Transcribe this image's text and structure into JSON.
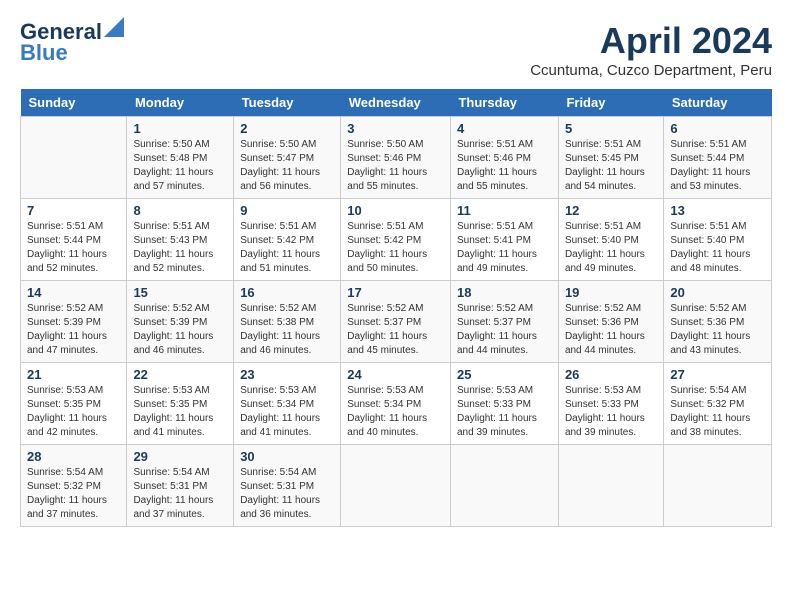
{
  "header": {
    "logo_line1": "General",
    "logo_line2": "Blue",
    "month_year": "April 2024",
    "location": "Ccuntuma, Cuzco Department, Peru"
  },
  "days_of_week": [
    "Sunday",
    "Monday",
    "Tuesday",
    "Wednesday",
    "Thursday",
    "Friday",
    "Saturday"
  ],
  "weeks": [
    [
      {
        "day": "",
        "sunrise": "",
        "sunset": "",
        "daylight": ""
      },
      {
        "day": "1",
        "sunrise": "Sunrise: 5:50 AM",
        "sunset": "Sunset: 5:48 PM",
        "daylight": "Daylight: 11 hours and 57 minutes."
      },
      {
        "day": "2",
        "sunrise": "Sunrise: 5:50 AM",
        "sunset": "Sunset: 5:47 PM",
        "daylight": "Daylight: 11 hours and 56 minutes."
      },
      {
        "day": "3",
        "sunrise": "Sunrise: 5:50 AM",
        "sunset": "Sunset: 5:46 PM",
        "daylight": "Daylight: 11 hours and 55 minutes."
      },
      {
        "day": "4",
        "sunrise": "Sunrise: 5:51 AM",
        "sunset": "Sunset: 5:46 PM",
        "daylight": "Daylight: 11 hours and 55 minutes."
      },
      {
        "day": "5",
        "sunrise": "Sunrise: 5:51 AM",
        "sunset": "Sunset: 5:45 PM",
        "daylight": "Daylight: 11 hours and 54 minutes."
      },
      {
        "day": "6",
        "sunrise": "Sunrise: 5:51 AM",
        "sunset": "Sunset: 5:44 PM",
        "daylight": "Daylight: 11 hours and 53 minutes."
      }
    ],
    [
      {
        "day": "7",
        "sunrise": "Sunrise: 5:51 AM",
        "sunset": "Sunset: 5:44 PM",
        "daylight": "Daylight: 11 hours and 52 minutes."
      },
      {
        "day": "8",
        "sunrise": "Sunrise: 5:51 AM",
        "sunset": "Sunset: 5:43 PM",
        "daylight": "Daylight: 11 hours and 52 minutes."
      },
      {
        "day": "9",
        "sunrise": "Sunrise: 5:51 AM",
        "sunset": "Sunset: 5:42 PM",
        "daylight": "Daylight: 11 hours and 51 minutes."
      },
      {
        "day": "10",
        "sunrise": "Sunrise: 5:51 AM",
        "sunset": "Sunset: 5:42 PM",
        "daylight": "Daylight: 11 hours and 50 minutes."
      },
      {
        "day": "11",
        "sunrise": "Sunrise: 5:51 AM",
        "sunset": "Sunset: 5:41 PM",
        "daylight": "Daylight: 11 hours and 49 minutes."
      },
      {
        "day": "12",
        "sunrise": "Sunrise: 5:51 AM",
        "sunset": "Sunset: 5:40 PM",
        "daylight": "Daylight: 11 hours and 49 minutes."
      },
      {
        "day": "13",
        "sunrise": "Sunrise: 5:51 AM",
        "sunset": "Sunset: 5:40 PM",
        "daylight": "Daylight: 11 hours and 48 minutes."
      }
    ],
    [
      {
        "day": "14",
        "sunrise": "Sunrise: 5:52 AM",
        "sunset": "Sunset: 5:39 PM",
        "daylight": "Daylight: 11 hours and 47 minutes."
      },
      {
        "day": "15",
        "sunrise": "Sunrise: 5:52 AM",
        "sunset": "Sunset: 5:39 PM",
        "daylight": "Daylight: 11 hours and 46 minutes."
      },
      {
        "day": "16",
        "sunrise": "Sunrise: 5:52 AM",
        "sunset": "Sunset: 5:38 PM",
        "daylight": "Daylight: 11 hours and 46 minutes."
      },
      {
        "day": "17",
        "sunrise": "Sunrise: 5:52 AM",
        "sunset": "Sunset: 5:37 PM",
        "daylight": "Daylight: 11 hours and 45 minutes."
      },
      {
        "day": "18",
        "sunrise": "Sunrise: 5:52 AM",
        "sunset": "Sunset: 5:37 PM",
        "daylight": "Daylight: 11 hours and 44 minutes."
      },
      {
        "day": "19",
        "sunrise": "Sunrise: 5:52 AM",
        "sunset": "Sunset: 5:36 PM",
        "daylight": "Daylight: 11 hours and 44 minutes."
      },
      {
        "day": "20",
        "sunrise": "Sunrise: 5:52 AM",
        "sunset": "Sunset: 5:36 PM",
        "daylight": "Daylight: 11 hours and 43 minutes."
      }
    ],
    [
      {
        "day": "21",
        "sunrise": "Sunrise: 5:53 AM",
        "sunset": "Sunset: 5:35 PM",
        "daylight": "Daylight: 11 hours and 42 minutes."
      },
      {
        "day": "22",
        "sunrise": "Sunrise: 5:53 AM",
        "sunset": "Sunset: 5:35 PM",
        "daylight": "Daylight: 11 hours and 41 minutes."
      },
      {
        "day": "23",
        "sunrise": "Sunrise: 5:53 AM",
        "sunset": "Sunset: 5:34 PM",
        "daylight": "Daylight: 11 hours and 41 minutes."
      },
      {
        "day": "24",
        "sunrise": "Sunrise: 5:53 AM",
        "sunset": "Sunset: 5:34 PM",
        "daylight": "Daylight: 11 hours and 40 minutes."
      },
      {
        "day": "25",
        "sunrise": "Sunrise: 5:53 AM",
        "sunset": "Sunset: 5:33 PM",
        "daylight": "Daylight: 11 hours and 39 minutes."
      },
      {
        "day": "26",
        "sunrise": "Sunrise: 5:53 AM",
        "sunset": "Sunset: 5:33 PM",
        "daylight": "Daylight: 11 hours and 39 minutes."
      },
      {
        "day": "27",
        "sunrise": "Sunrise: 5:54 AM",
        "sunset": "Sunset: 5:32 PM",
        "daylight": "Daylight: 11 hours and 38 minutes."
      }
    ],
    [
      {
        "day": "28",
        "sunrise": "Sunrise: 5:54 AM",
        "sunset": "Sunset: 5:32 PM",
        "daylight": "Daylight: 11 hours and 37 minutes."
      },
      {
        "day": "29",
        "sunrise": "Sunrise: 5:54 AM",
        "sunset": "Sunset: 5:31 PM",
        "daylight": "Daylight: 11 hours and 37 minutes."
      },
      {
        "day": "30",
        "sunrise": "Sunrise: 5:54 AM",
        "sunset": "Sunset: 5:31 PM",
        "daylight": "Daylight: 11 hours and 36 minutes."
      },
      {
        "day": "",
        "sunrise": "",
        "sunset": "",
        "daylight": ""
      },
      {
        "day": "",
        "sunrise": "",
        "sunset": "",
        "daylight": ""
      },
      {
        "day": "",
        "sunrise": "",
        "sunset": "",
        "daylight": ""
      },
      {
        "day": "",
        "sunrise": "",
        "sunset": "",
        "daylight": ""
      }
    ]
  ]
}
